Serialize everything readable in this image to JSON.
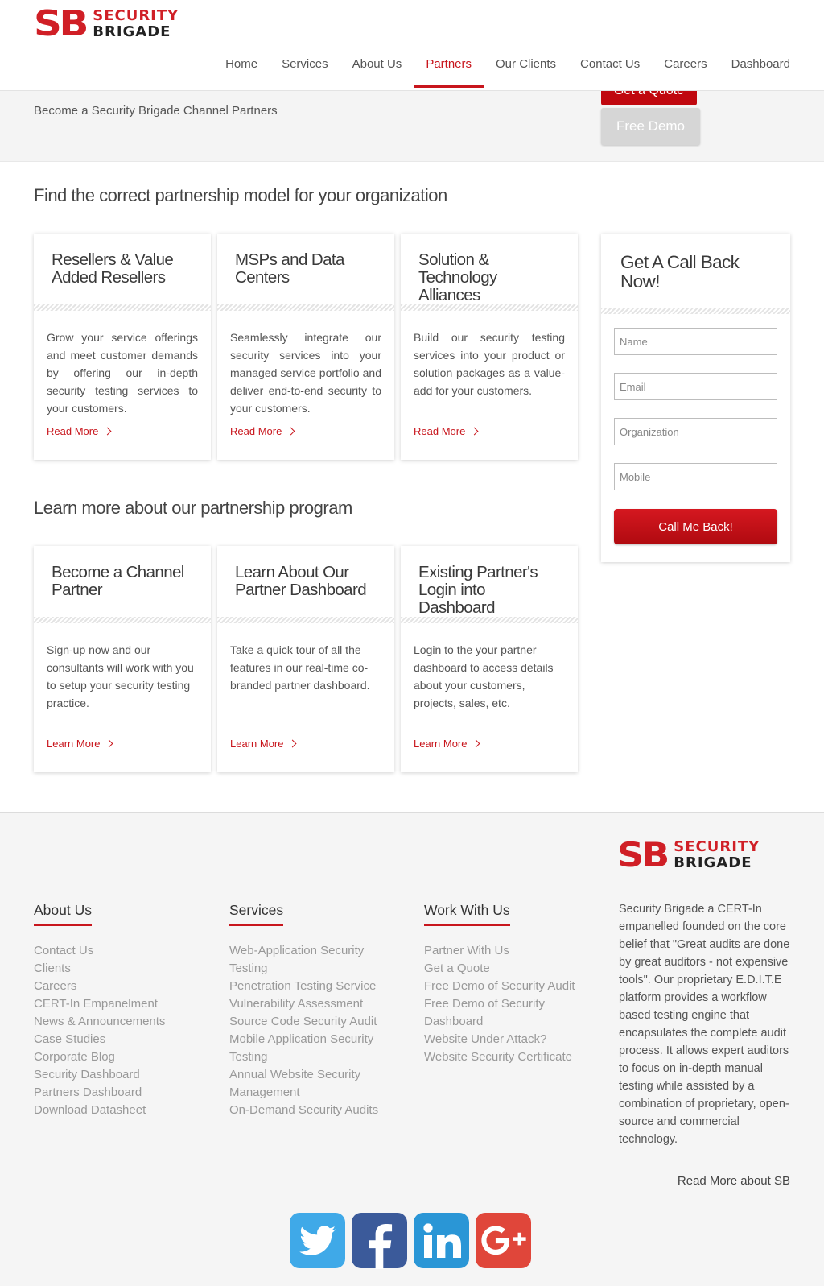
{
  "brand": {
    "logo_mark": "SB",
    "logo_word1": "SECURITY",
    "logo_word2": "BRIGADE"
  },
  "nav": {
    "items": [
      "Home",
      "Services",
      "About Us",
      "Partners",
      "Our Clients",
      "Contact Us",
      "Careers",
      "Dashboard"
    ],
    "active": "Partners"
  },
  "banner": {
    "text": "Become a Security Brigade Channel Partners",
    "quote_button": "Get a Quote",
    "demo_button": "Free Demo"
  },
  "section1": {
    "title": "Find the correct partnership model for your organization",
    "cards": [
      {
        "title": "Resellers & Value Added Resellers",
        "body": "Grow your service offerings and meet customer demands by offering our in-depth security testing services to your customers.",
        "link": "Read More"
      },
      {
        "title": "MSPs and Data Centers",
        "body": "Seamlessly integrate our security services into your managed service portfolio and deliver end-to-end security to your customers.",
        "link": "Read More"
      },
      {
        "title": "Solution & Technology Alliances",
        "body": "Build our security testing services into your product or solution packages as a value-add for your customers.",
        "link": "Read More"
      }
    ]
  },
  "section2": {
    "title": "Learn more about our partnership program",
    "cards": [
      {
        "title": "Become a Channel Partner",
        "body": "Sign-up now and our consultants will work with you to setup your security testing practice.",
        "link": "Learn More"
      },
      {
        "title": "Learn About Our Partner Dashboard",
        "body": "Take a quick tour of all the features in our real-time co-branded partner dashboard.",
        "link": "Learn More"
      },
      {
        "title": "Existing Partner's Login into Dashboard",
        "body": "Login to the your partner dashboard to access details about your customers, projects, sales, etc.",
        "link": "Learn More"
      }
    ]
  },
  "callback": {
    "title": "Get A Call Back Now!",
    "fields": [
      {
        "placeholder": "Name",
        "value": ""
      },
      {
        "placeholder": "Email",
        "value": ""
      },
      {
        "placeholder": "Organization",
        "value": ""
      },
      {
        "placeholder": "Mobile",
        "value": ""
      }
    ],
    "submit": "Call Me Back!"
  },
  "footer": {
    "columns": [
      {
        "heading": "About Us",
        "links": [
          "Contact Us",
          "Clients",
          "Careers",
          "CERT-In Empanelment",
          "News & Announcements",
          "Case Studies",
          "Corporate Blog",
          "Security Dashboard",
          "Partners Dashboard",
          "Download Datasheet"
        ]
      },
      {
        "heading": "Services",
        "links": [
          "Web-Application Security Testing",
          "Penetration Testing Service",
          "Vulnerability Assessment",
          "Source Code Security Audit",
          "Mobile Application Security Testing",
          "Annual Website Security Management",
          "On-Demand Security Audits"
        ]
      },
      {
        "heading": "Work With Us",
        "links": [
          "Partner With Us",
          "Get a Quote",
          "Free Demo of Security Audit",
          "Free Demo of Security Dashboard",
          "Website Under Attack?",
          "Website Security Certificate"
        ]
      }
    ],
    "about_text": "Security Brigade a CERT-In empanelled founded on the core belief that \"Great audits are done by great auditors - not expensive tools\". Our proprietary E.D.I.T.E platform provides a workflow based testing engine that encapsulates the complete audit process. It allows expert auditors to focus on in-depth manual testing while assisted by a combination of proprietary, open-source and commercial technology.",
    "read_more": "Read More about SB",
    "social": [
      {
        "icon": "twitter-icon",
        "color": "#3fa9e8"
      },
      {
        "icon": "facebook-icon",
        "color": "#3b5a9a"
      },
      {
        "icon": "linkedin-icon",
        "color": "#2a96d6"
      },
      {
        "icon": "googleplus-icon",
        "color": "#e0463a"
      }
    ]
  },
  "colors": {
    "accent": "#c8161d",
    "banner_bg": "#f4f4f4",
    "footer_bg": "#f5f5f5"
  }
}
